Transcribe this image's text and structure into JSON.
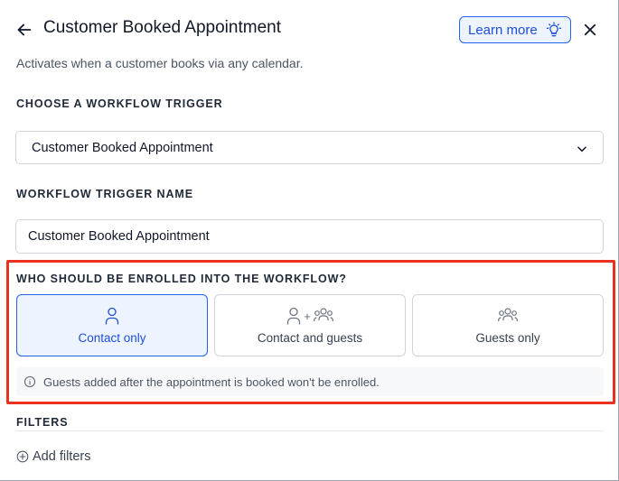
{
  "header": {
    "title": "Customer Booked Appointment",
    "learn_more_label": "Learn more",
    "back_icon": "arrow-left-icon",
    "close_icon": "close-icon",
    "learn_more_icon": "lightbulb-icon"
  },
  "subtitle": "Activates when a customer books via any calendar.",
  "trigger": {
    "section_label": "CHOOSE A WORKFLOW TRIGGER",
    "selected_value": "Customer Booked Appointment"
  },
  "trigger_name": {
    "section_label": "WORKFLOW TRIGGER NAME",
    "value": "Customer Booked Appointment"
  },
  "enrollment": {
    "section_label": "WHO SHOULD BE ENROLLED INTO THE WORKFLOW?",
    "options": [
      {
        "label": "Contact only",
        "icon": "person-icon",
        "selected": true
      },
      {
        "label": "Contact and guests",
        "icon": "person-plus-group-icon",
        "selected": false
      },
      {
        "label": "Guests only",
        "icon": "group-icon",
        "selected": false
      }
    ],
    "plus_sign": "+",
    "info_text": "Guests added after the appointment is booked won't be enrolled."
  },
  "filters": {
    "section_label": "FILTERS",
    "add_label": "Add filters"
  },
  "colors": {
    "accent": "#2563eb",
    "accent_bg": "#eef4ff",
    "highlight": "#e8321f"
  }
}
